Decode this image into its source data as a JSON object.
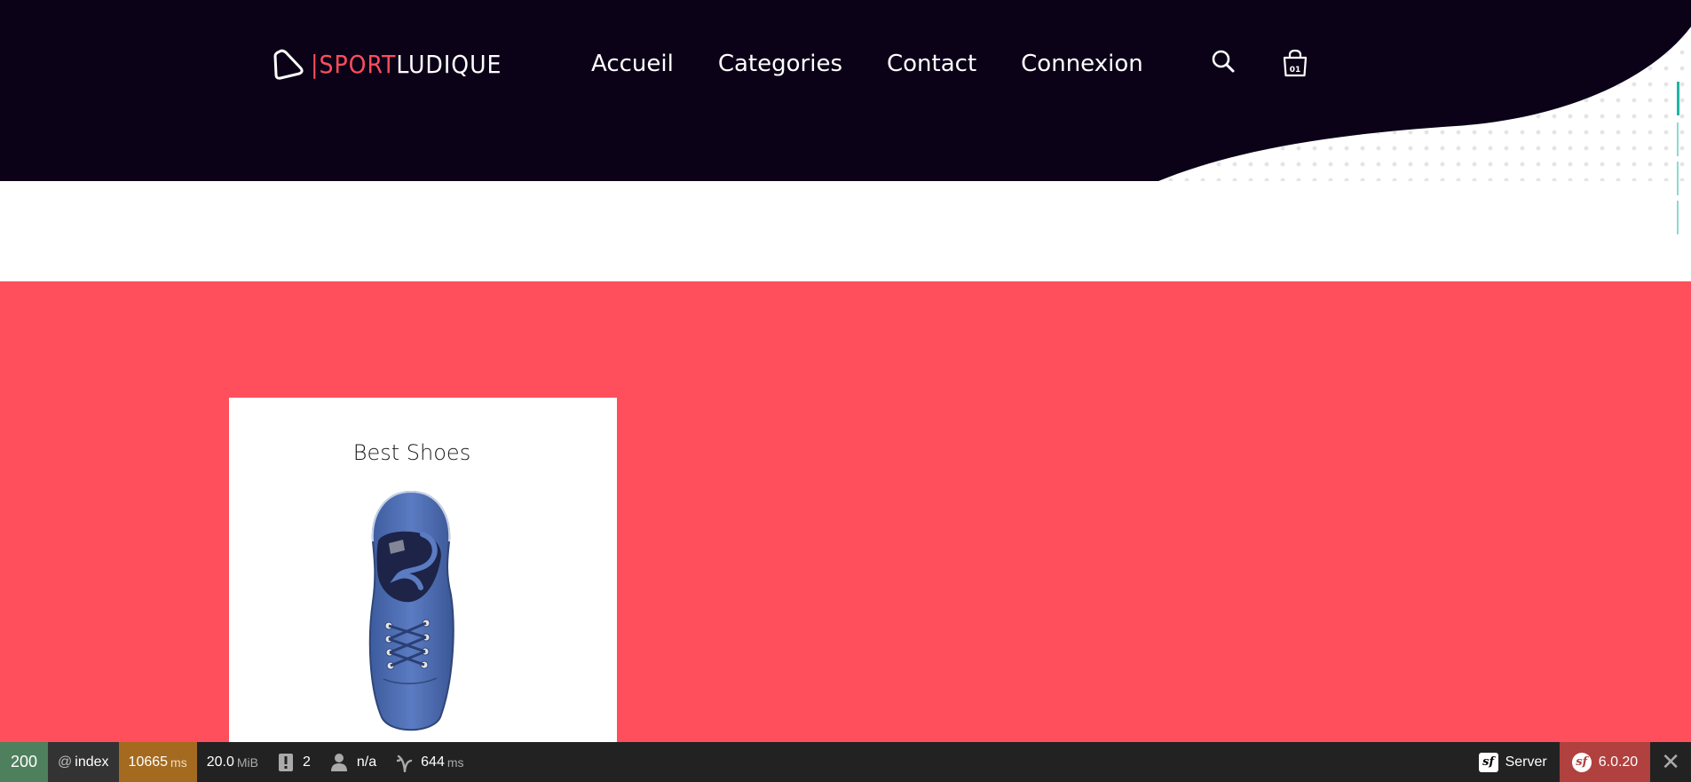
{
  "header": {
    "logo": {
      "prefix": "|",
      "sport": "SPORT",
      "ludique": "LUDIQUE"
    },
    "nav": [
      {
        "label": "Accueil"
      },
      {
        "label": "Categories"
      },
      {
        "label": "Contact"
      },
      {
        "label": "Connexion"
      }
    ],
    "icons": [
      "search-icon",
      "shopping-bag-icon"
    ],
    "cart_count": "01"
  },
  "colors": {
    "header_bg": "#0b0218",
    "accent_red": "#ff4e5c",
    "card_bg": "#ffffff",
    "teal_marker": "#1fb5a4"
  },
  "product_card": {
    "title": "Best Shoes",
    "image_icon": "blue-sneaker-image"
  },
  "toolbar": {
    "status": "200",
    "route_prefix": "@",
    "route": "index",
    "time_value": "10665",
    "time_unit": "ms",
    "memory_value": "20.0",
    "memory_unit": "MiB",
    "logs_count": "2",
    "user": "n/a",
    "twig_value": "644",
    "twig_unit": "ms",
    "server_label": "Server",
    "version": "6.0.20"
  }
}
